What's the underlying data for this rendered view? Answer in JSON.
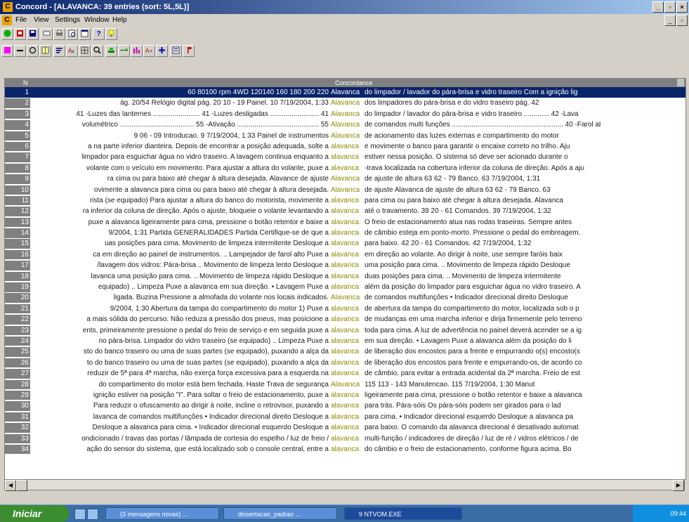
{
  "window": {
    "title": "Concord - [ALAVANCA: 39 entries (sort: 5L,5L)]",
    "app_icon": "C",
    "min": "_",
    "max": "▫",
    "close": "×"
  },
  "menu": {
    "icon": "C",
    "items": [
      "File",
      "View",
      "Settings",
      "Window",
      "Help"
    ]
  },
  "concordance": {
    "n_label": "N",
    "title": "Concordance",
    "rows": [
      {
        "n": "1",
        "left": "60   80100            rpm                    4WD  120140   160   180   200   220",
        "kw": "Alavanca",
        "right": "do limpador / lavador    do pára-brisa e vidro traseiro     Com a ignição lig"
      },
      {
        "n": "2",
        "left": "ág. 20/54 Relógio digital  pág. 20  10 - 19 Painel. 10       7/19/2004, 1:33",
        "kw": "Alavanca",
        "right": "dos limpadores  do pára-brisa e do  vidro traseiro  pág. 42"
      },
      {
        "n": "3",
        "left": "41 -Luzes das lanternes ........................ 41  -Luzes desligadas ......................... 41",
        "kw": "Alavanca",
        "right": "do limpador / lavador do  pára-brisa e vidro traseiro ............. 42       -Lava"
      },
      {
        "n": "4",
        "left": "volumétrico ...................................... 55  -Ativação .......................................... 55",
        "kw": "Alavanca",
        "right": "de comandos multi  funções ......................................................... 40  -Farol al"
      },
      {
        "n": "5",
        "left": "9     06 - 09 Introducao. 9       7/19/2004, 1:33      Painel de instrumentos",
        "kw": "Alavanca",
        "right": "de  acionamento das  luzes externas e    compartimento  do motor"
      },
      {
        "n": "6",
        "left": "a na parte   inferior dianteira. Depois de   encontrar a posição adequada,   solte a",
        "kw": "alavanca",
        "right": "e movimente o   banco para garantir o encaixe   correto no trilho.     Aju"
      },
      {
        "n": "7",
        "left": "limpador para esguichar água no   vidro traseiro. A lavagem continua   enquanto a",
        "kw": "alavanca",
        "right": "estiver nessa   posição.       O sistema só deve ser   acionado durante o"
      },
      {
        "n": "8",
        "left": "volante com o veículo em   movimento.   Para ajustar a altura do volante, puxe  a",
        "kw": "alavanca",
        "right": "-trava localizada na   cobertura inferior da coluna de   direção. Após a aju"
      },
      {
        "n": "9",
        "left": "ra cima ou para baixo até chegar à   altura desejada.    Alavance   de ajuste",
        "kw": "Alavanca",
        "right": "de ajuste  de altura  63      62 - 79 Banco. 63        7/19/2004, 1:31"
      },
      {
        "n": "10",
        "left": "ovimente a alavanca   para cima ou para baixo até chegar à   altura desejada.",
        "kw": "Alavanca",
        "right": "de ajuste        Alavanca de ajuste  de altura  63      62 - 79 Banco. 63"
      },
      {
        "n": "11",
        "left": "rista (se equipado)    Para ajustar a altura do banco do   motorista, movimente a",
        "kw": "alavanca",
        "right": "para cima ou para baixo até chegar à   altura desejada.        Alavanca"
      },
      {
        "n": "12",
        "left": "ra inferior da coluna de   direção. Após o ajuste, bloqueie o   volante levantando a",
        "kw": "alavanca",
        "right": "até o   travamento.   39      20 - 61 Comandos. 39       7/19/2004, 1:32"
      },
      {
        "n": "13",
        "left": "puxe a   alavanca ligeiramente para cima,   pressione o botão retentor e baixe a",
        "kw": "alavanca.",
        "right": "O freio de estacionamento atua nas   rodas traseiras.   Sempre antes"
      },
      {
        "n": "14",
        "left": "9/2004, 1:31     Partida  GENERALIDADES   Partida   Certifique-se de que a",
        "kw": "alavanca",
        "right": "de  câmbio esteja em ponto-morto.   Pressione o pedal do embreagem."
      },
      {
        "n": "15",
        "left": "uas posições   para cima.        Movimento de limpeza  intermitente   Desloque a",
        "kw": "alavanca",
        "right": "para baixo.        42      20 - 61 Comandos. 42        7/19/2004, 1:32"
      },
      {
        "n": "16",
        "left": "ca em direção ao   painel de instrumentos.      .. Lampejador de farol alto   Puxe a",
        "kw": "alavanca",
        "right": "em direção ao  volante.         Ao dirigir à noite, use sempre     faróis baix"
      },
      {
        "n": "17",
        "left": "/lavagem dos vidros:    Pára-brisa      .. Movimento de limpeza lento   Desloque a",
        "kw": "alavanca",
        "right": "uma posição   para cima.        .. Movimento de limpeza rápido   Desloque"
      },
      {
        "n": "18",
        "left": "lavanca uma posição   para cima.       .. Movimento de limpeza rápido   Desloque a",
        "kw": "alavanca",
        "right": "duas posições   para cima.        .. Movimento de limpeza   intermitente"
      },
      {
        "n": "19",
        "left": "equipado)     .. Limpeza   Puxe a alavanca em sua direção.    • Lavagem   Puxe a",
        "kw": "alavanca",
        "right": "além da posição do   limpador para esguichar água no   vidro traseiro.  A"
      },
      {
        "n": "20",
        "left": "ligada.    Buzina    Pressione a almofada do volante nos   locais indicados.",
        "kw": "Alavanca",
        "right": "de comandos   multifunções     • Indicador direcional direito   Desloque"
      },
      {
        "n": "21",
        "left": "9/2004, 1:30        Abertura da tampa do   compartimento do motor    1) Puxe a",
        "kw": "alavanca",
        "right": "de abertura da   tampa do compartimento do   motor, localizada sob o p"
      },
      {
        "n": "22",
        "left": "a mais sólida do percurso.  Não   reduza a pressão dos pneus, mas   posicione a",
        "kw": "alavanca",
        "right": "de mudanças   em uma marcha inferior e dirija   firmemente pelo terreno"
      },
      {
        "n": "23",
        "left": "ents, primeiramente   pressione o pedal do freio de serviço   e em seguida puxe a",
        "kw": "alavanca",
        "right": "toda   para cima. A luz de advertência no   painel deverá acender se a ig"
      },
      {
        "n": "24",
        "left": "no pára-brisa.    Limpador do vidro traseiro   (se equipado)     .. Limpeza   Puxe a",
        "kw": "alavanca",
        "right": "em sua direção.     • Lavagem   Puxe a alavanca além da posição do   li"
      },
      {
        "n": "25",
        "left": "sto do banco traseiro ou   uma de suas partes (se equipado),   puxando a alça da",
        "kw": "alavanca",
        "right": "de   liberação dos encostos para a frente   e empurrando o(s) encosto(s"
      },
      {
        "n": "26",
        "left": "to do   banco traseiro ou uma de suas   partes (se equipado), puxando a alça   da",
        "kw": "alavanca",
        "right": "de liberação dos   encostos para frente e empurrando-os,    de acordo co"
      },
      {
        "n": "27",
        "left": "reduzir de 5ª para 4ª   marcha, não exerça força   excessiva para a esquerda na",
        "kw": "alavanca",
        "right": "de câmbio, para evitar a   entrada acidental da 2ª marcha.   Freio de est"
      },
      {
        "n": "28",
        "left": "do   compartimento do motor está   bem fechada.       Haste   Trava de segurança",
        "kw": "Alavanca",
        "right": "115       113 - 143 Manutencao. 115         7/19/2004, 1:30         Manut"
      },
      {
        "n": "29",
        "left": "ignição   estiver na posição \"I\". Para soltar o   freio de estacionamento, puxe a",
        "kw": "alavanca",
        "right": "ligeiramente para cima,   pressione o botão retentor e baixe a   alavanca"
      },
      {
        "n": "30",
        "left": "Para reduzir o ofuscamento ao   dirigir à noite, incline o retrovisor,   puxando a",
        "kw": "alavanca",
        "right": "para trás.       Pára-sóis     Os pára-sóis podem ser girados para     o lad"
      },
      {
        "n": "31",
        "left": "lavanca de comandos   multifunções    • Indicador direcional direito   Desloque a",
        "kw": "alavanca",
        "right": "para cima.          • Indicador direcional esquerdo   Desloque a alavanca pa"
      },
      {
        "n": "32",
        "left": "Desloque a alavanca para cima.        • Indicador direcional esquerdo   Desloque a",
        "kw": "alavanca",
        "right": "para baixo.    O comando da alavanca direcional é   desativado automat"
      },
      {
        "n": "33",
        "left": "ondicionado / travas das portas /   lâmpada de cortesia do espelho / luz de freio /",
        "kw": "alavanca",
        "right": "multi-função / indicadores de direção / luz de ré / vidros   elétricos / de"
      },
      {
        "n": "34",
        "left": "ação do sensor do sistema, que   está localizado sob o console central,   entre a",
        "kw": "alavanca",
        "right": "do câmbio e o freio   de estacionamento, conforme figura   acima.     Bo"
      }
    ]
  },
  "taskbar": {
    "start": "Iniciar",
    "tasks": [
      "(3 mensagens novas) ...",
      "dissertacao_padrao ...",
      "9 NTVOM.EXE"
    ],
    "clock": "09:44"
  },
  "colors": {
    "title_gradient_start": "#0a246a",
    "selection": "#0a246a",
    "keyword": "#8b8b00",
    "row_number_bg": "#808080"
  }
}
